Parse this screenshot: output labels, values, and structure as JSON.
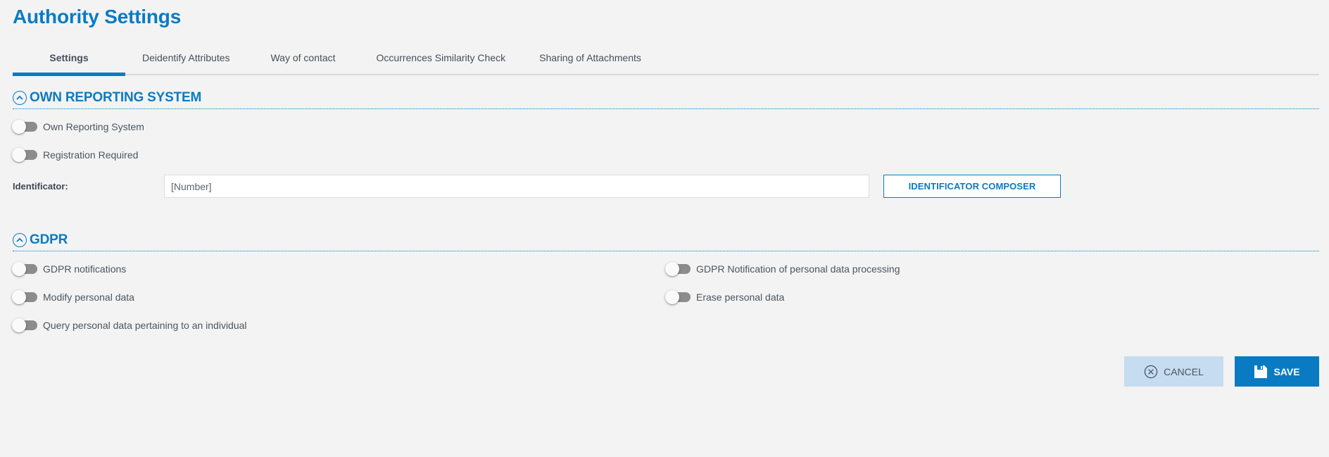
{
  "page": {
    "title": "Authority Settings"
  },
  "tabs": [
    {
      "label": "Settings",
      "active": true
    },
    {
      "label": "Deidentify Attributes",
      "active": false
    },
    {
      "label": "Way of contact",
      "active": false
    },
    {
      "label": "Occurrences Similarity Check",
      "active": false
    },
    {
      "label": "Sharing of Attachments",
      "active": false
    }
  ],
  "own_reporting": {
    "section_title": "OWN REPORTING SYSTEM",
    "section_icon": "chevron-up-circle-icon",
    "toggles": [
      {
        "label": "Own Reporting System",
        "on": false
      },
      {
        "label": "Registration Required",
        "on": false
      }
    ],
    "identificator": {
      "label": "Identificator:",
      "value": "[Number]",
      "button_label": "IDENTIFICATOR COMPOSER"
    }
  },
  "gdpr": {
    "section_title": "GDPR",
    "section_icon": "chevron-up-circle-icon",
    "toggles": [
      {
        "label": "GDPR notifications",
        "on": false
      },
      {
        "label": "GDPR Notification of personal data processing",
        "on": false
      },
      {
        "label": "Modify personal data",
        "on": false
      },
      {
        "label": "Erase personal data",
        "on": false
      },
      {
        "label": "Query personal data pertaining to an individual",
        "on": false
      }
    ]
  },
  "actions": {
    "cancel_label": "CANCEL",
    "cancel_icon": "close-circle-icon",
    "save_label": "SAVE",
    "save_icon": "floppy-disk-icon"
  },
  "colors": {
    "accent": "#0a7bc2",
    "cancel_bg": "#c6dcf1",
    "toggle_track_off": "#8c8c8c",
    "background": "#f3f3f3"
  }
}
